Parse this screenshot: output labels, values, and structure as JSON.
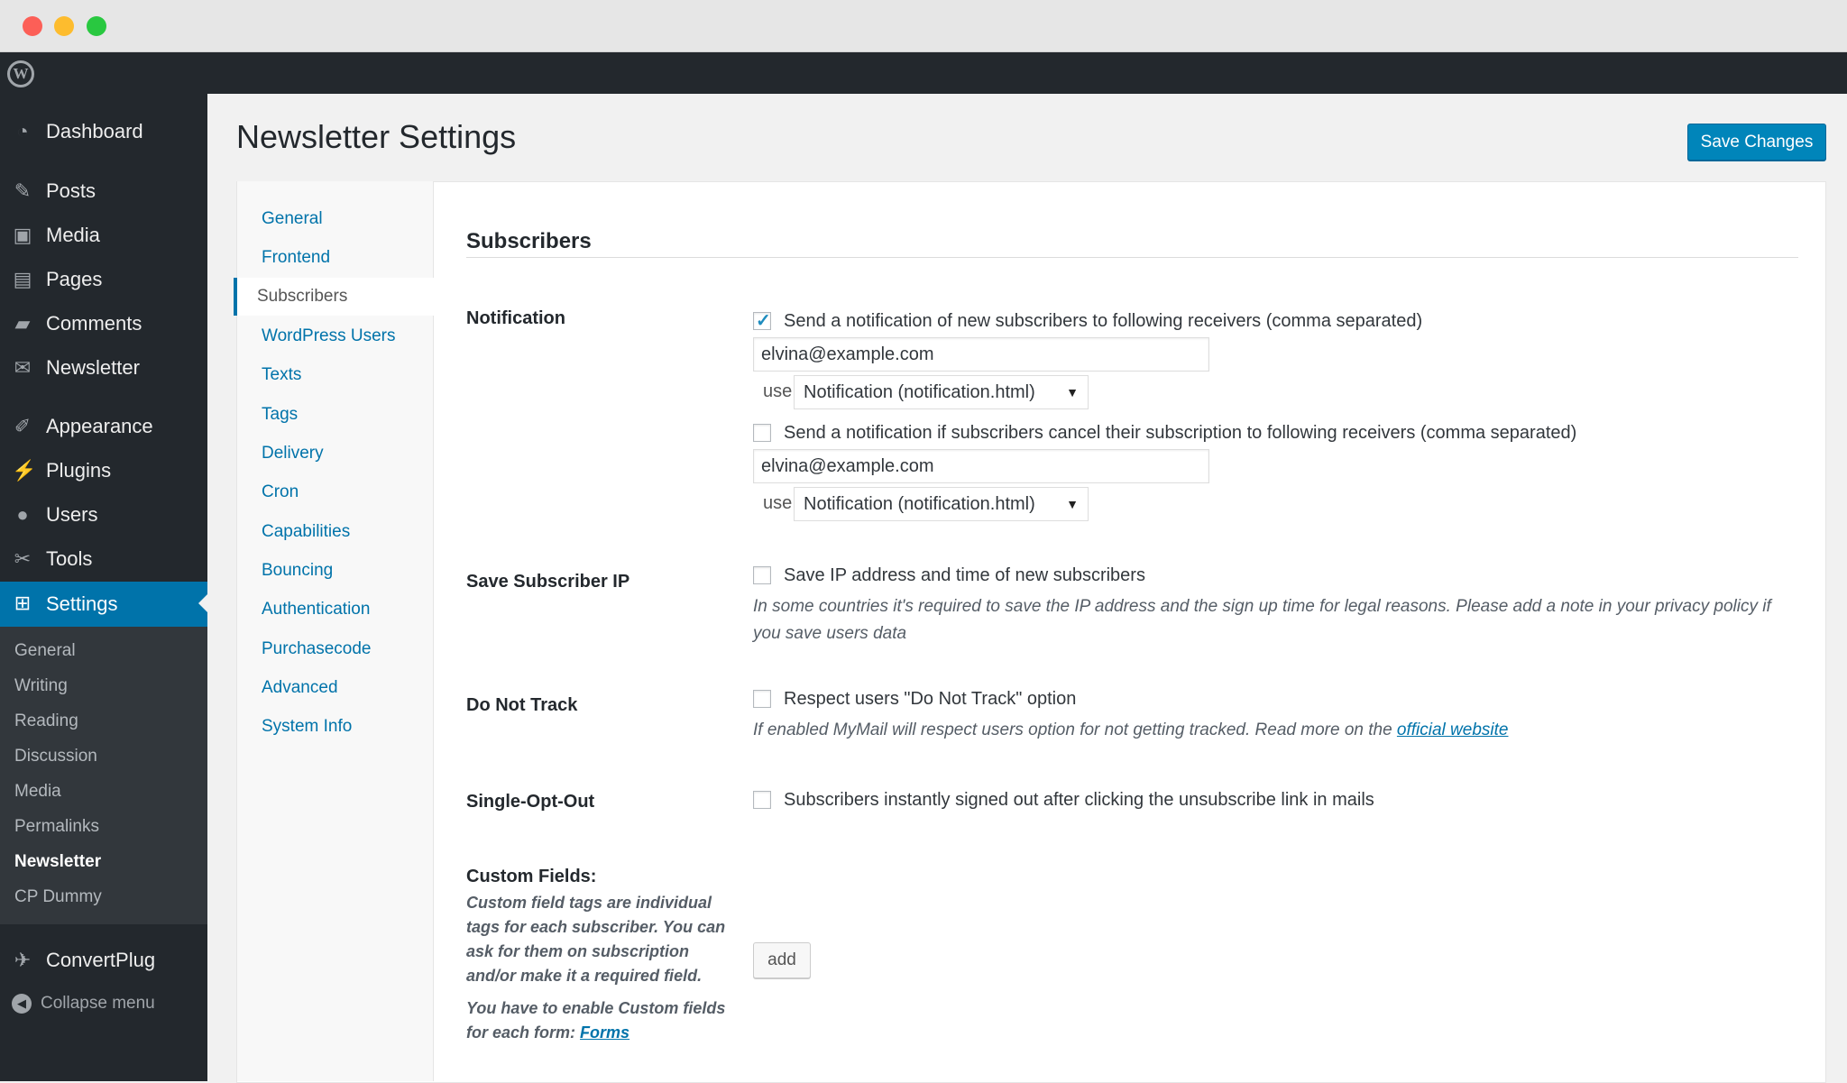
{
  "admin_menu": {
    "items": [
      {
        "label": "Dashboard",
        "icon": "dashboard-icon"
      },
      {
        "label": "Posts",
        "icon": "pin-icon"
      },
      {
        "label": "Media",
        "icon": "media-icon"
      },
      {
        "label": "Pages",
        "icon": "pages-icon"
      },
      {
        "label": "Comments",
        "icon": "comment-icon"
      },
      {
        "label": "Newsletter",
        "icon": "envelope-icon"
      },
      {
        "label": "Appearance",
        "icon": "brush-icon"
      },
      {
        "label": "Plugins",
        "icon": "plug-icon"
      },
      {
        "label": "Users",
        "icon": "user-icon"
      },
      {
        "label": "Tools",
        "icon": "wrench-icon"
      },
      {
        "label": "Settings",
        "icon": "settings-icon"
      },
      {
        "label": "ConvertPlug",
        "icon": "convertplug-icon"
      }
    ],
    "submenu": [
      "General",
      "Writing",
      "Reading",
      "Discussion",
      "Media",
      "Permalinks",
      "Newsletter",
      "CP Dummy"
    ],
    "current_submenu": "Newsletter",
    "collapse_label": "Collapse menu"
  },
  "page": {
    "title": "Newsletter Settings",
    "save_label": "Save Changes"
  },
  "tabs": [
    "General",
    "Frontend",
    "Subscribers",
    "WordPress Users",
    "Texts",
    "Tags",
    "Delivery",
    "Cron",
    "Capabilities",
    "Bouncing",
    "Authentication",
    "Purchasecode",
    "Advanced",
    "System Info"
  ],
  "active_tab": "Subscribers",
  "section": {
    "title": "Subscribers",
    "notification": {
      "label": "Notification",
      "new_subscriber_checked": true,
      "new_subscriber_text": "Send a notification of new subscribers to following receivers (comma separated)",
      "new_subscriber_email": "elvina@example.com",
      "use_label": "use",
      "new_subscriber_template": "Notification (notification.html)",
      "cancel_checked": false,
      "cancel_text": "Send a notification if subscribers cancel their subscription to following receivers (comma separated)",
      "cancel_email": "elvina@example.com",
      "cancel_template": "Notification (notification.html)"
    },
    "save_ip": {
      "label": "Save Subscriber IP",
      "option_text": "Save IP address and time of new subscribers",
      "description": "In some countries it's required to save the IP address and the sign up time for legal reasons. Please add a note in your privacy policy if you save users data"
    },
    "do_not_track": {
      "label": "Do Not Track",
      "option_text": "Respect users \"Do Not Track\" option",
      "description": "If enabled MyMail will respect users option for not getting tracked. Read more on the",
      "link_text": "official website"
    },
    "single_opt_out": {
      "label": "Single-Opt-Out",
      "option_text": "Subscribers instantly signed out after clicking the unsubscribe link in mails"
    },
    "custom_fields": {
      "label": "Custom Fields:",
      "description": "Custom field tags are individual tags for each subscriber. You can ask for them on subscription and/or make it a required field.",
      "enable_note": "You have to enable Custom fields for each form:",
      "forms_link": "Forms",
      "add_label": "add"
    }
  }
}
